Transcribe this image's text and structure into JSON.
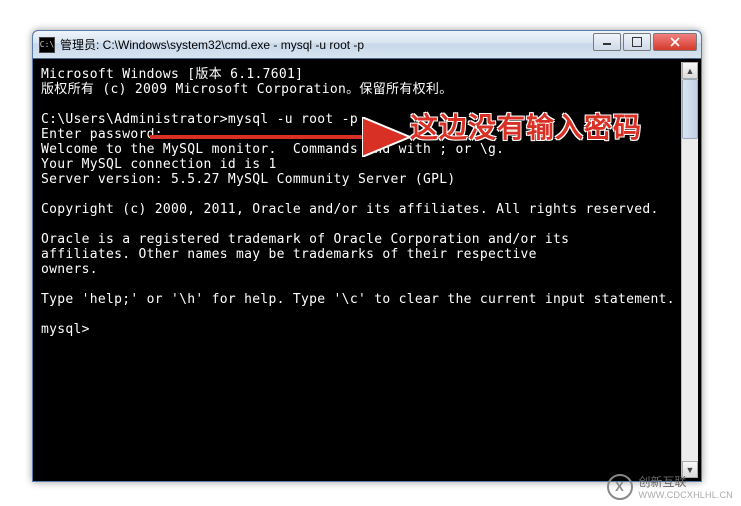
{
  "window": {
    "title_prefix": "管理员: ",
    "title_path": "C:\\Windows\\system32\\cmd.exe - mysql  -u root -p",
    "icon_label": "C:\\"
  },
  "controls": {
    "minimize": "minimize",
    "maximize": "maximize",
    "close": "close"
  },
  "terminal": {
    "lines": [
      "Microsoft Windows [版本 6.1.7601]",
      "版权所有 (c) 2009 Microsoft Corporation。保留所有权利。",
      "",
      "C:\\Users\\Administrator>mysql -u root -p",
      "Enter password:",
      "Welcome to the MySQL monitor.  Commands end with ; or \\g.",
      "Your MySQL connection id is 1",
      "Server version: 5.5.27 MySQL Community Server (GPL)",
      "",
      "Copyright (c) 2000, 2011, Oracle and/or its affiliates. All rights reserved.",
      "",
      "Oracle is a registered trademark of Oracle Corporation and/or its",
      "affiliates. Other names may be trademarks of their respective",
      "owners.",
      "",
      "Type 'help;' or '\\h' for help. Type '\\c' to clear the current input statement.",
      "",
      "mysql>"
    ]
  },
  "annotation": {
    "text": "这边没有输入密码"
  },
  "watermark": {
    "brand": "创新互联",
    "domain": "WWW.CDCXHLHL.CN",
    "logo_letter": "X"
  },
  "colors": {
    "annotation_red": "#d93025",
    "terminal_bg": "#000000",
    "terminal_fg": "#ffffff"
  }
}
